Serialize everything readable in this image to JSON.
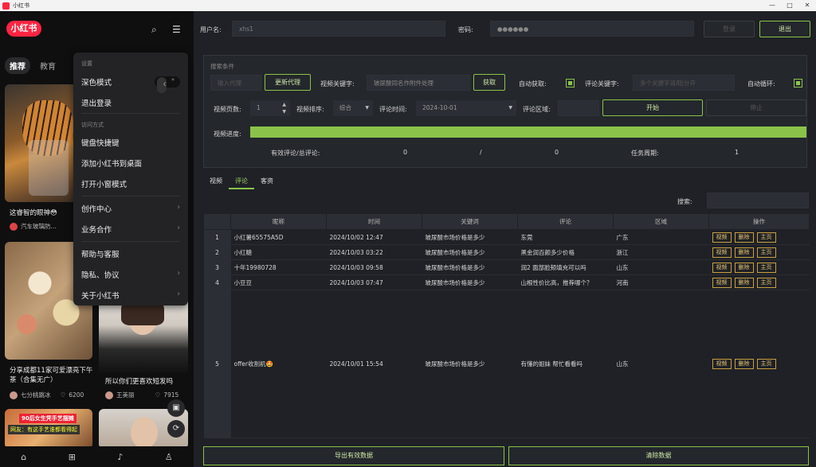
{
  "titlebar": {
    "title": "小红书",
    "controls": [
      "—",
      "□",
      "✕"
    ]
  },
  "left": {
    "logo": "小红书",
    "tabs": [
      "推荐",
      "教育"
    ],
    "cards": [
      {
        "title": "这睿智的眼神😳",
        "author": "汽车玻璃防...",
        "likes": ""
      },
      {
        "title": "分享成都11家可爱漂亮下午茶（合集无广）",
        "author": "七分桃跳冰",
        "likes": "6200"
      },
      {
        "title": "所以你们更喜欢短发吗",
        "author": "王美丽",
        "likes": "7915"
      },
      {
        "title": "",
        "author": "",
        "likes": ""
      }
    ],
    "bottom_banner": "90后女生凭手艺摆摊",
    "bottom_banner2": "网友：有这手艺谁都看得起"
  },
  "menu": {
    "sec1": "设置",
    "dark_mode": "深色模式",
    "toggle": [
      "⇄",
      "☀",
      "☾"
    ],
    "logout": "退出登录",
    "sec2": "访问方式",
    "shortcut": "键盘快捷键",
    "add_desktop": "添加小红书到桌面",
    "small_window": "打开小窗模式",
    "creator": "创作中心",
    "business": "业务合作",
    "help": "帮助与客服",
    "privacy": "隐私、协议",
    "about": "关于小红书"
  },
  "login": {
    "user_label": "用户名:",
    "user_value": "xhs1",
    "pwd_label": "密码:",
    "pwd_value": "●●●●●●",
    "login_btn": "登录",
    "exit_btn": "退出"
  },
  "search": {
    "title": "搜索条件",
    "proxy_placeholder": "输入代理",
    "update_proxy": "更新代理",
    "video_kw_label": "视频关键字:",
    "video_kw_value": "玻尿酸同名作附件处理",
    "fetch": "获取",
    "auto_fetch_label": "自动获取:",
    "comment_kw_label": "评论关键字:",
    "comment_kw_placeholder": "多个关键字请用|分开",
    "auto_loop_label": "自动循环:",
    "pages_label": "视频页数:",
    "pages_value": "1",
    "sort_label": "视频排序:",
    "sort_value": "综合",
    "time_label": "评论时间:",
    "time_value": "2024-10-01",
    "region_label": "评论区域:",
    "region_value": "",
    "start": "开始",
    "stop": "停止",
    "progress_label": "视频进度:",
    "progress": 1.0,
    "valid_label": "有效评论/总评论:",
    "valid": "0",
    "slash": "/",
    "total": "0",
    "cycle_label": "任务周期:",
    "cycle": "1"
  },
  "result_tabs": [
    "视频",
    "评论",
    "客资"
  ],
  "table_search_label": "搜索:",
  "table": {
    "headers": [
      "",
      "昵称",
      "时间",
      "关键词",
      "评论",
      "区域",
      "操作"
    ],
    "rows": [
      {
        "idx": "1",
        "nick": "小红薯65575A5D",
        "time": "2024/10/02 12:47",
        "kw": "玻尿酸市场价格是多少",
        "comment": "东莞",
        "region": "广东"
      },
      {
        "idx": "2",
        "nick": "小红糖",
        "time": "2024/10/03 03:22",
        "kw": "玻尿酸市场价格是多少",
        "comment": "黑金润百颜多少价格",
        "region": "浙江"
      },
      {
        "idx": "3",
        "nick": "十年19980728",
        "time": "2024/10/03 09:58",
        "kw": "玻尿酸市场价格是多少",
        "comment": "润2 面部脸颊填充可以吗",
        "region": "山东"
      },
      {
        "idx": "4",
        "nick": "小豆豆",
        "time": "2024/10/03 07:47",
        "kw": "玻尿酸市场价格是多少",
        "comment": "山根性价比高，推荐哪个？",
        "region": "河南"
      },
      {
        "idx": "5",
        "nick": "offer收割机🤩",
        "time": "2024/10/01 15:54",
        "kw": "玻尿酸市场价格是多少",
        "comment": "有懂的姐妹 帮忙看看吗",
        "region": "山东"
      }
    ],
    "actions": [
      "视频",
      "删除",
      "主页"
    ]
  },
  "footer": {
    "export": "导出有效数据",
    "clear": "清除数据"
  },
  "colors": {
    "accent": "#8bc34a",
    "brand": "#ff2442",
    "action": "#c8a040"
  }
}
